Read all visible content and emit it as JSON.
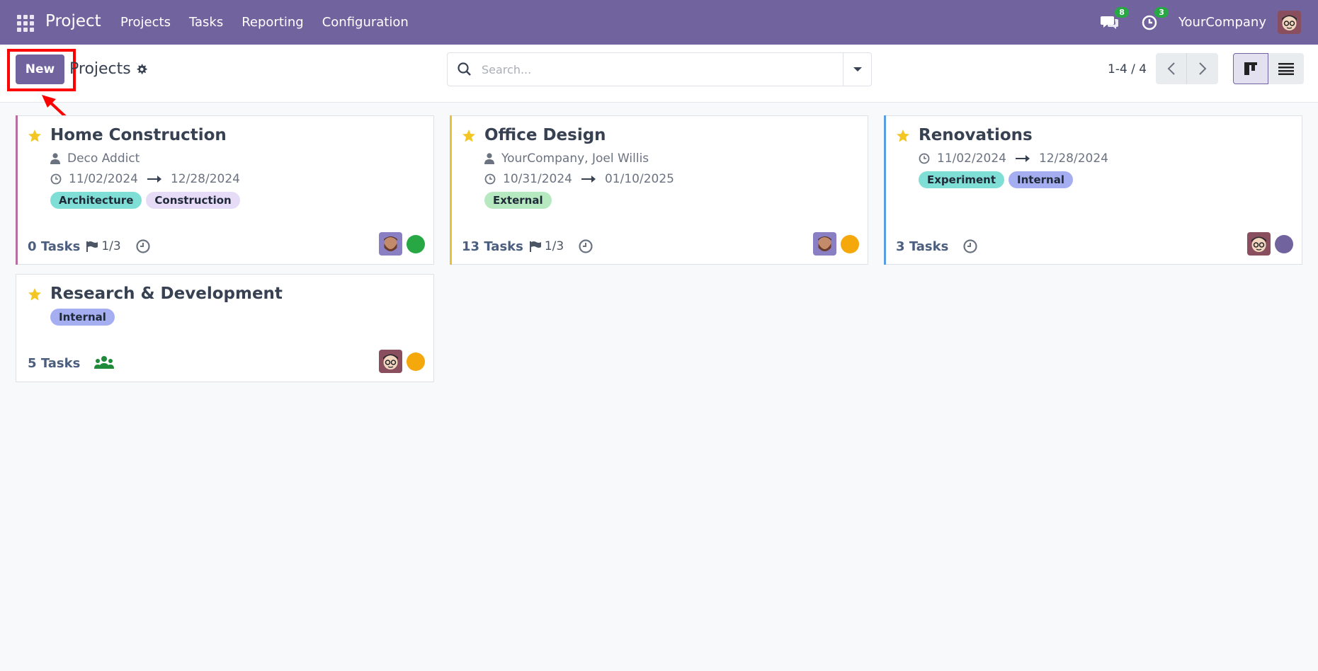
{
  "nav": {
    "brand": "Project",
    "menu": [
      "Projects",
      "Tasks",
      "Reporting",
      "Configuration"
    ],
    "messages_count": "8",
    "activities_count": "3",
    "company": "YourCompany"
  },
  "control": {
    "new_label": "New",
    "breadcrumb": "Projects",
    "search_placeholder": "Search...",
    "pager": "1-4 / 4"
  },
  "colors": {
    "brand": "#71639e",
    "green": "#28a745",
    "orange": "#f4a80c",
    "purple": "#71639e"
  },
  "cards": [
    {
      "title": "Home Construction",
      "customer": "Deco Addict",
      "date_start": "11/02/2024",
      "date_end": "12/28/2024",
      "tags": [
        "Architecture",
        "Construction"
      ],
      "tasks_count": "0",
      "tasks_word": "Tasks",
      "milestones": "1/3"
    },
    {
      "title": "Office Design",
      "customer": "YourCompany, Joel Willis",
      "date_start": "10/31/2024",
      "date_end": "01/10/2025",
      "tags": [
        "External"
      ],
      "tasks_count": "13",
      "tasks_word": "Tasks",
      "milestones": "1/3"
    },
    {
      "title": "Renovations",
      "date_start": "11/02/2024",
      "date_end": "12/28/2024",
      "tags": [
        "Experiment",
        "Internal"
      ],
      "tasks_count": "3",
      "tasks_word": "Tasks"
    },
    {
      "title": "Research & Development",
      "tags": [
        "Internal"
      ],
      "tasks_count": "5",
      "tasks_word": "Tasks"
    }
  ]
}
